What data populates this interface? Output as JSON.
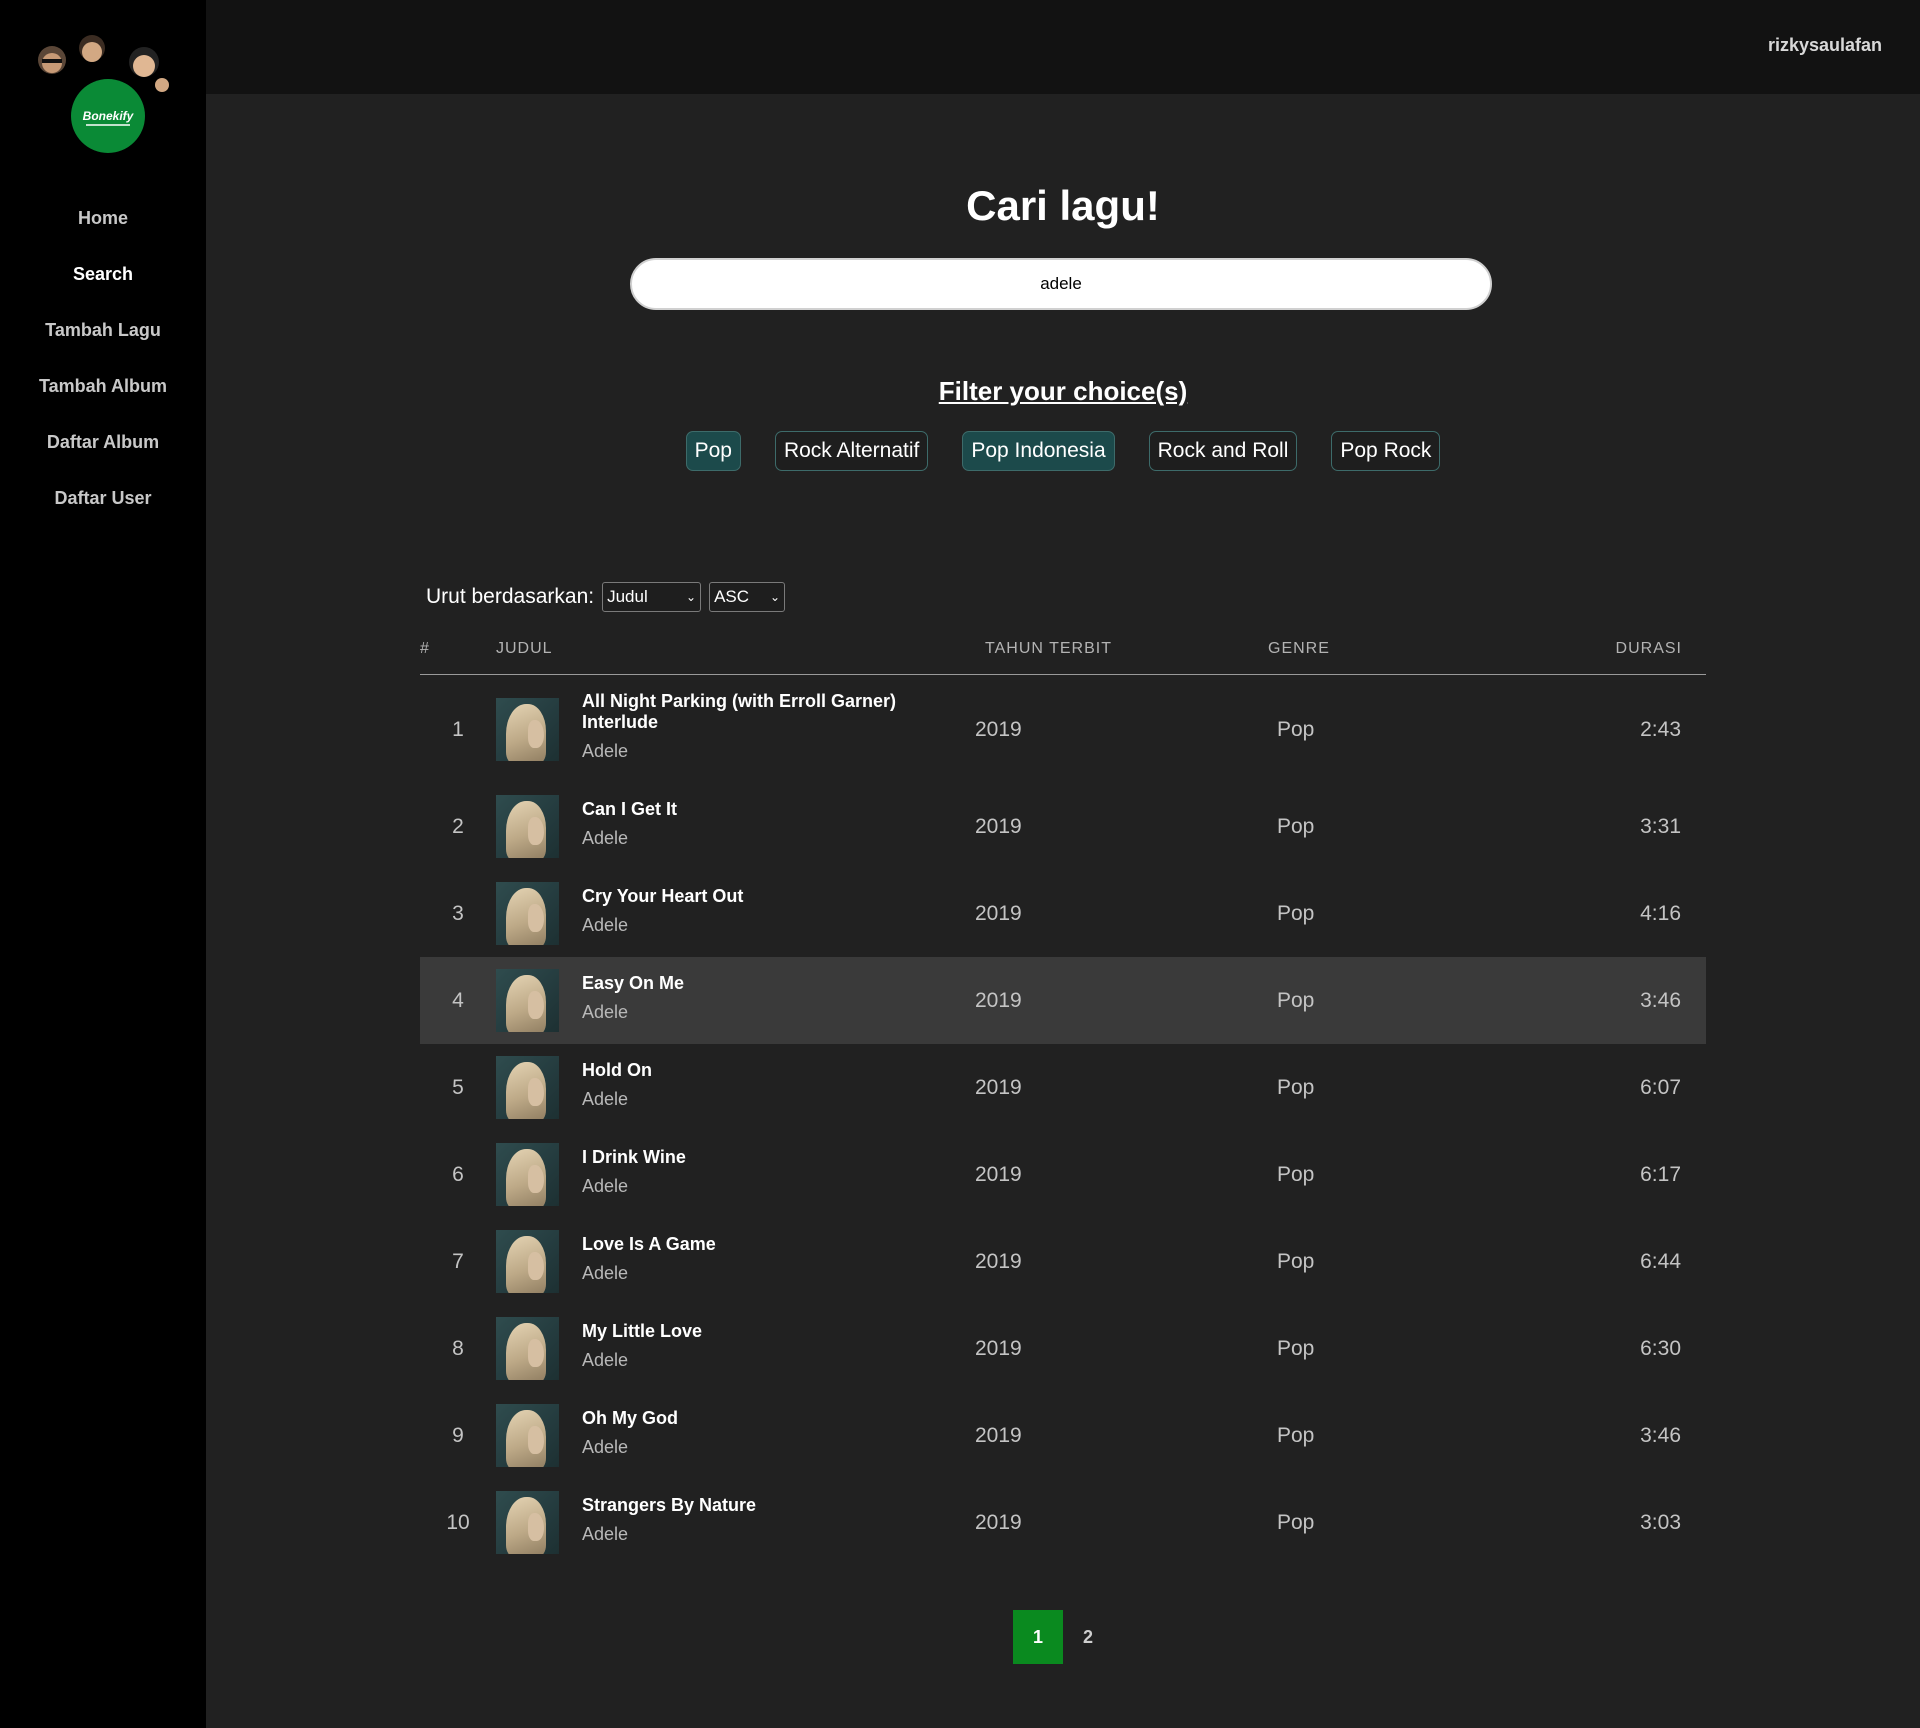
{
  "sidebar": {
    "logo_text": "Bonekify",
    "items": [
      {
        "label": "Home",
        "active": false
      },
      {
        "label": "Search",
        "active": true
      },
      {
        "label": "Tambah Lagu",
        "active": false
      },
      {
        "label": "Tambah Album",
        "active": false
      },
      {
        "label": "Daftar Album",
        "active": false
      },
      {
        "label": "Daftar User",
        "active": false
      }
    ]
  },
  "header": {
    "username": "rizkysaulafan"
  },
  "search": {
    "title": "Cari lagu!",
    "value": "adele"
  },
  "filter": {
    "title": "Filter your choice(s)",
    "chips": [
      {
        "label": "Pop",
        "selected": true
      },
      {
        "label": "Rock Alternatif",
        "selected": false
      },
      {
        "label": "Pop Indonesia",
        "selected": true
      },
      {
        "label": "Rock and Roll",
        "selected": false
      },
      {
        "label": "Pop Rock",
        "selected": false
      }
    ]
  },
  "sort": {
    "label": "Urut berdasarkan:",
    "field": "Judul",
    "order": "ASC"
  },
  "table": {
    "headers": {
      "num": "#",
      "title": "JUDUL",
      "year": "TAHUN TERBIT",
      "genre": "GENRE",
      "duration": "DURASI"
    },
    "rows": [
      {
        "num": "1",
        "title": "All Night Parking (with Erroll Garner) Interlude",
        "artist": "Adele",
        "year": "2019",
        "genre": "Pop",
        "duration": "2:43"
      },
      {
        "num": "2",
        "title": "Can I Get It",
        "artist": "Adele",
        "year": "2019",
        "genre": "Pop",
        "duration": "3:31"
      },
      {
        "num": "3",
        "title": "Cry Your Heart Out",
        "artist": "Adele",
        "year": "2019",
        "genre": "Pop",
        "duration": "4:16"
      },
      {
        "num": "4",
        "title": "Easy On Me",
        "artist": "Adele",
        "year": "2019",
        "genre": "Pop",
        "duration": "3:46"
      },
      {
        "num": "5",
        "title": "Hold On",
        "artist": "Adele",
        "year": "2019",
        "genre": "Pop",
        "duration": "6:07"
      },
      {
        "num": "6",
        "title": "I Drink Wine",
        "artist": "Adele",
        "year": "2019",
        "genre": "Pop",
        "duration": "6:17"
      },
      {
        "num": "7",
        "title": "Love Is A Game",
        "artist": "Adele",
        "year": "2019",
        "genre": "Pop",
        "duration": "6:44"
      },
      {
        "num": "8",
        "title": "My Little Love",
        "artist": "Adele",
        "year": "2019",
        "genre": "Pop",
        "duration": "6:30"
      },
      {
        "num": "9",
        "title": "Oh My God",
        "artist": "Adele",
        "year": "2019",
        "genre": "Pop",
        "duration": "3:46"
      },
      {
        "num": "10",
        "title": "Strangers By Nature",
        "artist": "Adele",
        "year": "2019",
        "genre": "Pop",
        "duration": "3:03"
      }
    ]
  },
  "pagination": {
    "pages": [
      "1",
      "2"
    ],
    "current": "1"
  },
  "colors": {
    "accent": "#0a8a1f",
    "chip_selected": "#1c4a4b",
    "row_highlight": "#3a3a3a"
  }
}
